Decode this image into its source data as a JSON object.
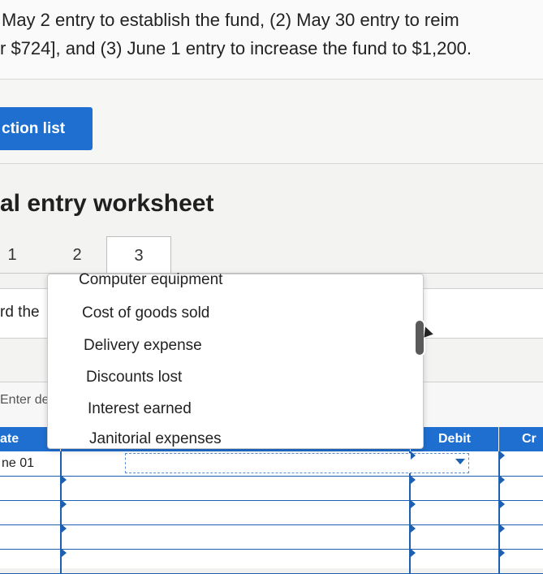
{
  "intro": {
    "line1": "May 2 entry to establish the fund, (2) May 30 entry to reim",
    "line2": "r $724], and (3) June 1 entry to increase the fund to $1,200."
  },
  "transaction_list_button": "ction list",
  "worksheet": {
    "title": "al entry worksheet",
    "tabs": [
      "1",
      "2",
      "3"
    ],
    "record_text": "rd the",
    "enter_text": "Enter deb"
  },
  "dropdown": {
    "items": [
      "Computer equipment",
      "Cost of goods sold",
      "Delivery expense",
      "Discounts lost",
      "Interest earned",
      "Janitorial expenses"
    ]
  },
  "table": {
    "headers": {
      "date": "ate",
      "debit": "Debit",
      "credit": "Cr"
    },
    "rows": [
      {
        "date": "ne 01"
      },
      {
        "date": ""
      },
      {
        "date": ""
      },
      {
        "date": ""
      },
      {
        "date": ""
      }
    ]
  },
  "colors": {
    "accent": "#1f6fd0",
    "grid_line": "#1d5fb0"
  }
}
